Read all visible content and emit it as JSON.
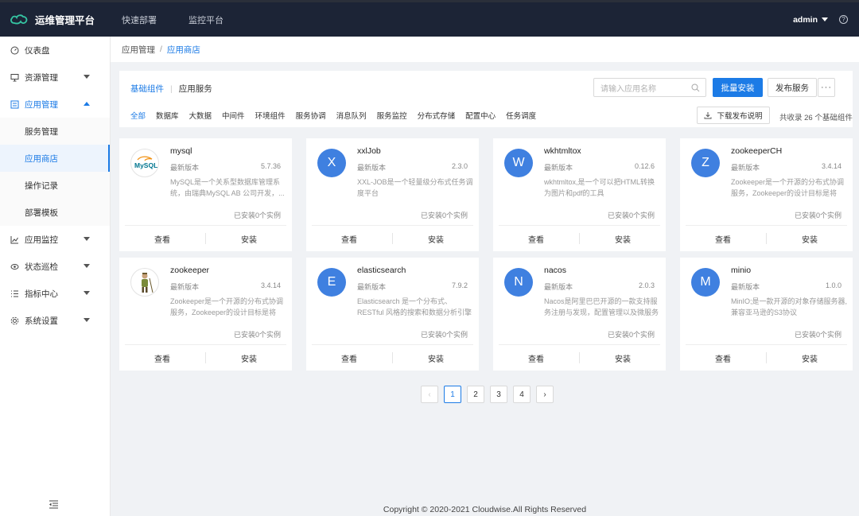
{
  "app": {
    "title": "运维管理平台",
    "user": "admin",
    "help_icon": "help-icon",
    "accent": "#1c7be6",
    "topbar_color": "#1c2436"
  },
  "topnav": [
    "快速部署",
    "监控平台"
  ],
  "sidebar": {
    "items": [
      {
        "label": "仪表盘",
        "icon": "dashboard-icon"
      },
      {
        "label": "资源管理",
        "icon": "monitor-icon"
      },
      {
        "label": "应用管理",
        "icon": "app-icon"
      },
      {
        "label": "应用监控",
        "icon": "chart-icon"
      },
      {
        "label": "状态巡检",
        "icon": "eye-icon"
      },
      {
        "label": "指标中心",
        "icon": "list-icon"
      },
      {
        "label": "系统设置",
        "icon": "gear-icon"
      }
    ],
    "subitems": [
      "服务管理",
      "应用商店",
      "操作记录",
      "部署模板"
    ]
  },
  "breadcrumb": {
    "parent": "应用管理",
    "current": "应用商店"
  },
  "panel": {
    "tab_active": "基础组件",
    "tab_other": "应用服务",
    "search_placeholder": "请输入应用名称",
    "batch_install": "批量安装",
    "publish_service": "发布服务",
    "more": "···",
    "categories": [
      "全部",
      "数据库",
      "大数据",
      "中间件",
      "环境组件",
      "服务协调",
      "消息队列",
      "服务监控",
      "分布式存储",
      "配置中心",
      "任务调度"
    ],
    "download_label": "下载发布说明",
    "total_text": "共收录 26 个基础组件"
  },
  "cards": [
    {
      "name": "mysql",
      "avatar": "",
      "version_label": "最新版本",
      "version": "5.7.36",
      "desc": "MySQL是一个关系型数据库管理系统，由瑞典MySQL AB 公司开发，...",
      "installed": "已安装0个实例",
      "view": "查看",
      "install": "安装",
      "logo_text": "MySQL"
    },
    {
      "name": "xxlJob",
      "avatar": "X",
      "version_label": "最新版本",
      "version": "2.3.0",
      "desc": "XXL-JOB是一个轻量级分布式任务调度平台",
      "installed": "已安装0个实例",
      "view": "查看",
      "install": "安装"
    },
    {
      "name": "wkhtmltox",
      "avatar": "W",
      "version_label": "最新版本",
      "version": "0.12.6",
      "desc": "wkhtmltox,是一个可以把HTML转换为图片和pdf的工具",
      "installed": "已安装0个实例",
      "view": "查看",
      "install": "安装"
    },
    {
      "name": "zookeeperCH",
      "avatar": "Z",
      "version_label": "最新版本",
      "version": "3.4.14",
      "desc": "Zookeeper是一个开源的分布式协调服务，Zookeeper的设计目标是将那...",
      "installed": "已安装0个实例",
      "view": "查看",
      "install": "安装"
    },
    {
      "name": "zookeeper",
      "avatar": "",
      "version_label": "最新版本",
      "version": "3.4.14",
      "desc": "Zookeeper是一个开源的分布式协调服务，Zookeeper的设计目标是将那...",
      "installed": "已安装0个实例",
      "view": "查看",
      "install": "安装"
    },
    {
      "name": "elasticsearch",
      "avatar": "E",
      "version_label": "最新版本",
      "version": "7.9.2",
      "desc": "Elasticsearch 是一个分布式、RESTful 风格的搜索和数据分析引擎",
      "installed": "已安装0个实例",
      "view": "查看",
      "install": "安装"
    },
    {
      "name": "nacos",
      "avatar": "N",
      "version_label": "最新版本",
      "version": "2.0.3",
      "desc": "Nacos是阿里巴巴开源的一款支持服务注册与发现，配置管理以及微服务管...",
      "installed": "已安装0个实例",
      "view": "查看",
      "install": "安装"
    },
    {
      "name": "minio",
      "avatar": "M",
      "version_label": "最新版本",
      "version": "1.0.0",
      "desc": "MinIO;是一款开源的对象存储服务器,兼容亚马逊的S3协议",
      "installed": "已安装0个实例",
      "view": "查看",
      "install": "安装"
    }
  ],
  "pagination": {
    "pages": [
      "1",
      "2",
      "3",
      "4"
    ],
    "current": "1",
    "prev": "‹",
    "next": "›"
  },
  "footer": "Copyright © 2020-2021 Cloudwise.All Rights Reserved"
}
